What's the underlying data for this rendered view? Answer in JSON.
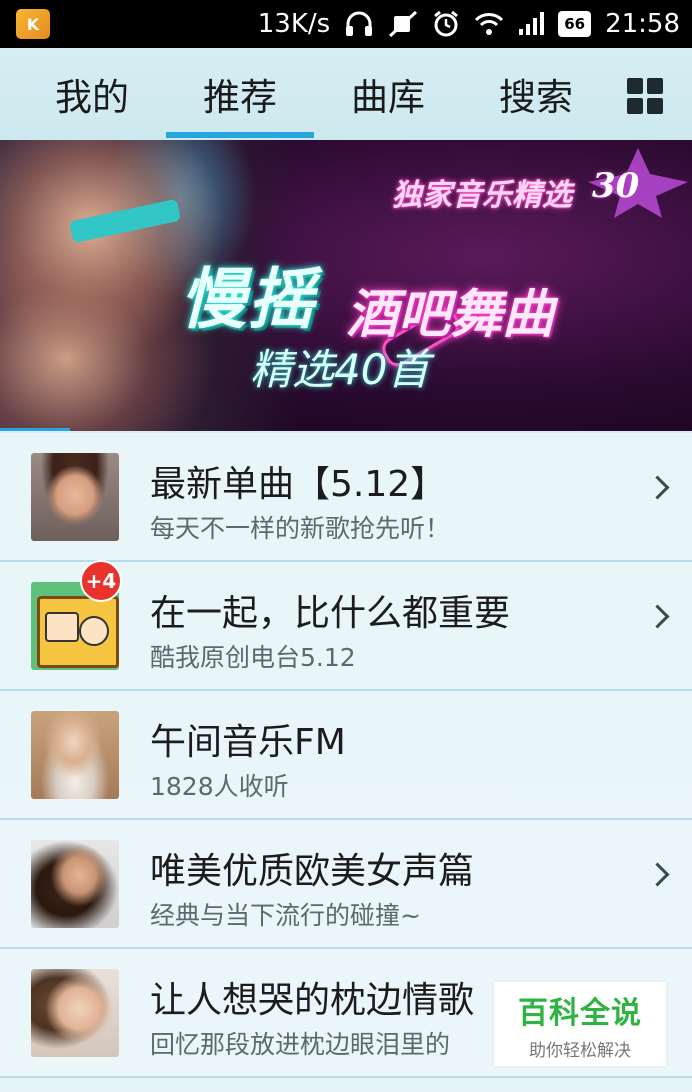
{
  "status_bar": {
    "speed": "13K/s",
    "battery": "66",
    "time": "21:58",
    "icons": [
      "headphones-icon",
      "mute-icon",
      "alarm-icon",
      "wifi-icon",
      "signal-icon",
      "battery-icon"
    ]
  },
  "tabs": [
    {
      "label": "我的",
      "active": false
    },
    {
      "label": "推荐",
      "active": true
    },
    {
      "label": "曲库",
      "active": false
    },
    {
      "label": "搜索",
      "active": false
    }
  ],
  "banner": {
    "top_text": "独家音乐精选",
    "badge_number": "30",
    "title_part1": "慢摇",
    "title_part2": "酒吧舞曲",
    "subtitle": "精选40首"
  },
  "list": [
    {
      "title": "最新单曲【5.12】",
      "subtitle": "每天不一样的新歌抢先听！",
      "has_arrow": true
    },
    {
      "title": "在一起，比什么都重要",
      "subtitle": "酷我原创电台5.12",
      "has_arrow": true,
      "badge": "+4"
    },
    {
      "title": "午间音乐FM",
      "subtitle": "1828人收听",
      "has_arrow": false
    },
    {
      "title": "唯美优质欧美女声篇",
      "subtitle": "经典与当下流行的碰撞~",
      "has_arrow": true
    },
    {
      "title": "让人想哭的枕边情歌",
      "subtitle": "回忆那段放进枕边眼泪里的",
      "has_arrow": false
    }
  ],
  "watermark": {
    "main": "百科全说",
    "sub": "助你轻松解决"
  },
  "colors": {
    "accent": "#27a5dc",
    "badge": "#e8322b",
    "watermark_green": "#2db441"
  }
}
